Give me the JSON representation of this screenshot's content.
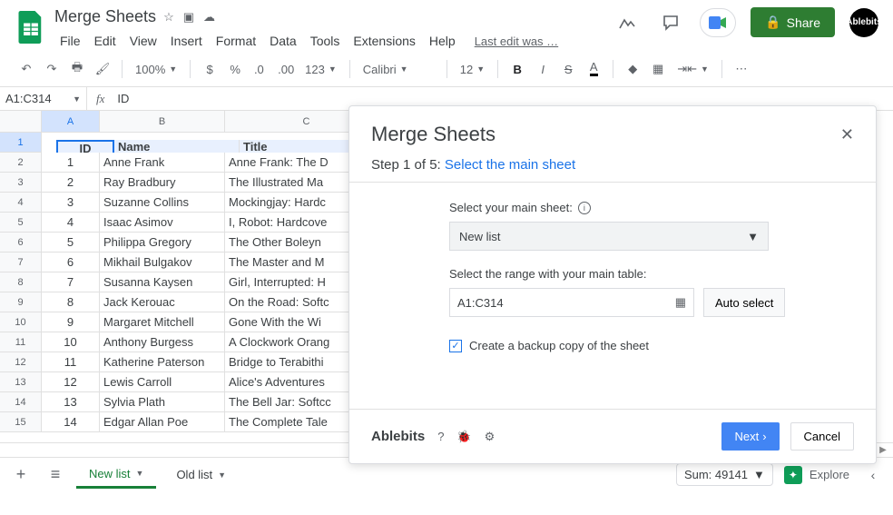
{
  "doc": {
    "title": "Merge Sheets"
  },
  "menubar": [
    "File",
    "Edit",
    "View",
    "Insert",
    "Format",
    "Data",
    "Tools",
    "Extensions",
    "Help"
  ],
  "last_edit": "Last edit was …",
  "share_label": "Share",
  "avatar": "Ablebits",
  "toolbar": {
    "zoom": "100%",
    "font": "Calibri",
    "size": "12"
  },
  "namebox": "A1:C314",
  "formula_val": "ID",
  "columns": [
    "A",
    "B",
    "C"
  ],
  "header_row": [
    "ID",
    "Name",
    "Title"
  ],
  "rows": [
    {
      "n": "1",
      "id": "1",
      "name": "Anne Frank",
      "title": "Anne Frank: The D"
    },
    {
      "n": "2",
      "id": "2",
      "name": "Ray Bradbury",
      "title": "The Illustrated Ma"
    },
    {
      "n": "3",
      "id": "3",
      "name": "Suzanne Collins",
      "title": "Mockingjay: Hardc"
    },
    {
      "n": "4",
      "id": "4",
      "name": "Isaac Asimov",
      "title": "I, Robot: Hardcove"
    },
    {
      "n": "5",
      "id": "5",
      "name": "Philippa Gregory",
      "title": "The Other Boleyn"
    },
    {
      "n": "6",
      "id": "6",
      "name": "Mikhail Bulgakov",
      "title": "The Master and M"
    },
    {
      "n": "7",
      "id": "7",
      "name": "Susanna Kaysen",
      "title": "Girl, Interrupted: H"
    },
    {
      "n": "8",
      "id": "8",
      "name": "Jack Kerouac",
      "title": "On the Road: Softc"
    },
    {
      "n": "9",
      "id": "9",
      "name": "Margaret Mitchell",
      "title": "Gone With the Wi"
    },
    {
      "n": "10",
      "id": "10",
      "name": "Anthony Burgess",
      "title": "A Clockwork Orang"
    },
    {
      "n": "11",
      "id": "11",
      "name": "Katherine Paterson",
      "title": "Bridge to Terabithi"
    },
    {
      "n": "12",
      "id": "12",
      "name": "Lewis Carroll",
      "title": "Alice's Adventures"
    },
    {
      "n": "13",
      "id": "13",
      "name": "Sylvia Plath",
      "title": "The Bell Jar: Softcc"
    },
    {
      "n": "14",
      "id": "14",
      "name": "Edgar Allan Poe",
      "title": "The Complete Tale"
    }
  ],
  "tabs": [
    {
      "label": "New list",
      "active": true
    },
    {
      "label": "Old list",
      "active": false
    }
  ],
  "sum": "Sum: 49141",
  "explore": "Explore",
  "dialog": {
    "title": "Merge Sheets",
    "step_prefix": "Step 1 of 5: ",
    "step_link": "Select the main sheet",
    "select_label": "Select your main sheet:",
    "selected_sheet": "New list",
    "range_label": "Select the range with your main table:",
    "range_value": "A1:C314",
    "auto_select": "Auto select",
    "backup_label": "Create a backup copy of the sheet",
    "brand": "Ablebits",
    "next": "Next",
    "cancel": "Cancel"
  }
}
